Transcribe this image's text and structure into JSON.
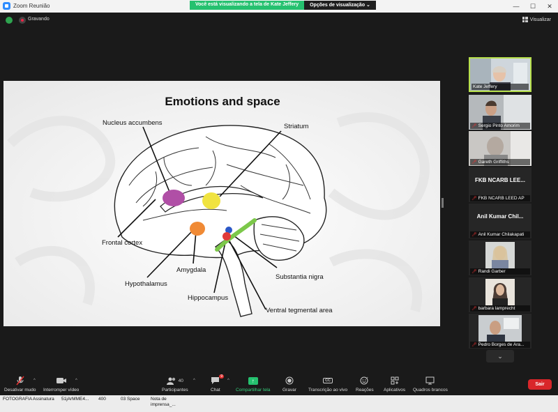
{
  "window": {
    "title": "Zoom Reunião",
    "share_message": "Você está visualizando a tela de Kate Jeffery",
    "view_options": "Opções de visualização"
  },
  "status": {
    "recording": "Gravando",
    "view": "Visualizar"
  },
  "slide": {
    "title": "Emotions and space",
    "labels": {
      "nucleus_accumbens": "Nucleus accumbens",
      "striatum": "Striatum",
      "frontal_cortex": "Frontal cortex",
      "amygdala": "Amygdala",
      "hypothalamus": "Hypothalamus",
      "substantia_nigra": "Substantia nigra",
      "hippocampus": "Hippocampus",
      "ventral_tegmental_area": "Ventral tegmental area"
    },
    "colors": {
      "nucleus_accumbens": "#b04fa6",
      "striatum": "#f0e340",
      "amygdala": "#f08a35",
      "hippocampus": "#7cc84a",
      "vta_blue": "#2b58c7",
      "vta_red": "#e13a3a"
    }
  },
  "participants": [
    {
      "name": "Kate Jeffery",
      "active": true,
      "muted": false,
      "has_video": true
    },
    {
      "name": "Sergio Pinto Amorim",
      "active": false,
      "muted": true,
      "has_video": true
    },
    {
      "name": "Gareth Griffiths",
      "active": false,
      "muted": true,
      "has_video": true
    },
    {
      "name": "FKB NCARB LEED AP",
      "big_label": "FKB NCARB LEE...",
      "active": false,
      "muted": true,
      "has_video": false
    },
    {
      "name": "Anil Kumar Chilakapati",
      "big_label": "Anil Kumar Chil...",
      "active": false,
      "muted": true,
      "has_video": false
    },
    {
      "name": "Randi Garber",
      "active": false,
      "muted": true,
      "has_video": true
    },
    {
      "name": "barbara lamprecht",
      "active": false,
      "muted": true,
      "has_video": true
    },
    {
      "name": "Pedro Borges de Ara...",
      "active": false,
      "muted": true,
      "has_video": true
    }
  ],
  "toolbar": {
    "mute": "Desativar mudo",
    "video": "Interromper vídeo",
    "participants": "Participantes",
    "participants_count": "40",
    "chat": "Chat",
    "chat_badge": "9",
    "share": "Compartilhar tela",
    "record": "Gravar",
    "transcription": "Transcrição ao vivo",
    "reactions": "Reações",
    "apps": "Aplicativos",
    "whiteboards": "Quadros brancos",
    "leave": "Sair",
    "cc": "CC"
  },
  "taskbar": {
    "items": [
      "FOTOGRAFIA",
      "Assinatura",
      "51jArMME4...",
      "400",
      "03 Space",
      "Nota de\nimprensa_..."
    ]
  },
  "icons": {
    "shield": "shield-icon",
    "record": "record-dot-icon",
    "grid": "grid-view-icon"
  }
}
